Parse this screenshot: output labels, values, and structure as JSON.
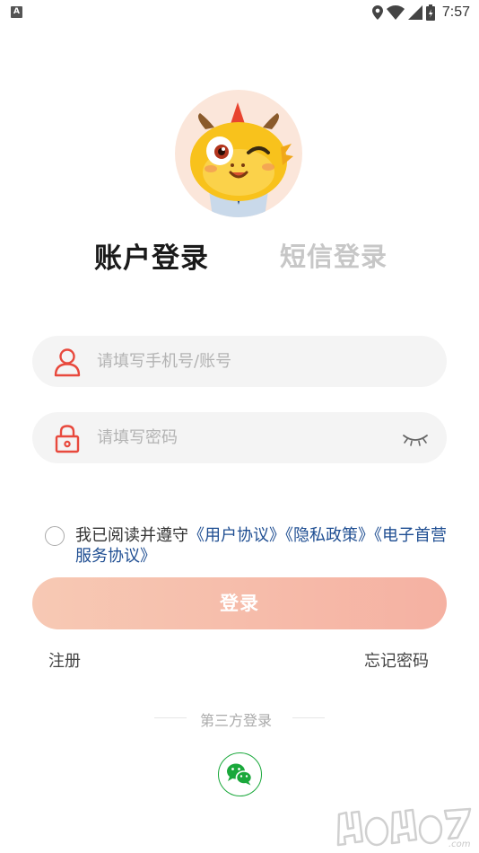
{
  "status_bar": {
    "time": "7:57",
    "left_icon": "A"
  },
  "avatar": {
    "icon": "dragon-mascot"
  },
  "tabs": [
    {
      "label": "账户登录",
      "active": true
    },
    {
      "label": "短信登录",
      "active": false
    }
  ],
  "phone_field": {
    "placeholder": "请填写手机号/账号",
    "value": ""
  },
  "password_field": {
    "placeholder": "请填写密码",
    "value": ""
  },
  "agreement": {
    "prefix": "我已阅读并遵守",
    "link_user": "《用户协议》",
    "link_privacy": "《隐私政策》",
    "link_service": "《电子首营服务协议》"
  },
  "login_button": "登录",
  "register_link": "注册",
  "forgot_link": "忘记密码",
  "third_party": {
    "label": "第三方登录",
    "wechat_icon": "wechat-icon"
  },
  "colors": {
    "accent_red": "#e8493d",
    "button_start": "#f7c9b4",
    "button_end": "#f5b1a2",
    "link_blue": "#1f4e92",
    "wechat_green": "#1aa83b"
  }
}
